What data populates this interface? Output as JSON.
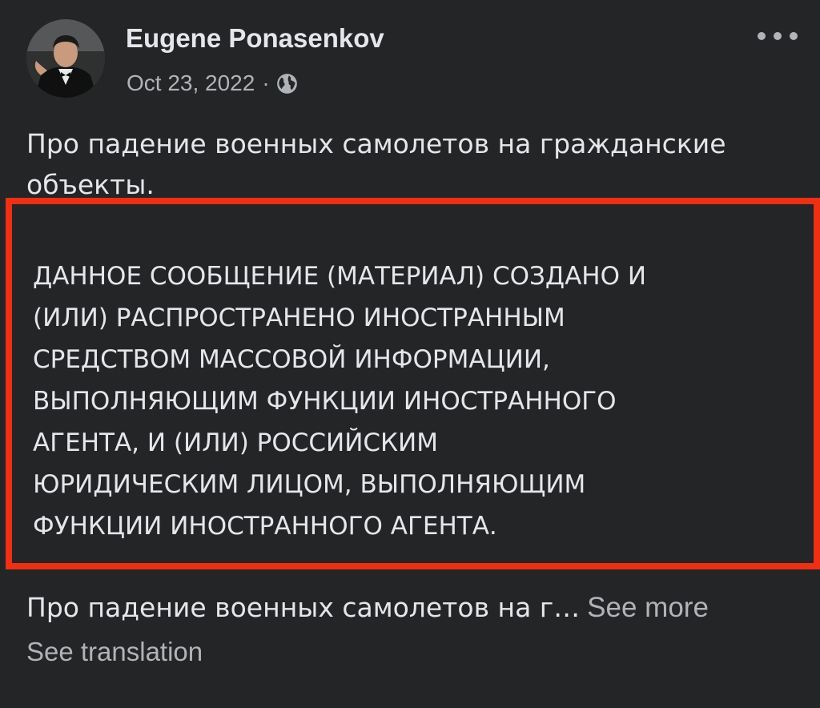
{
  "post": {
    "author_name": "Eugene Ponasenkov",
    "date": "Oct 23, 2022",
    "separator": "·",
    "visibility_icon": "globe-icon",
    "menu_icon": "more-options-icon",
    "intro_text": "Про падение военных самолетов на гражданские объекты.",
    "disclaimer_text": "ДАННОЕ СООБЩЕНИЕ (МАТЕРИАЛ) СОЗДАНО И\n(ИЛИ) РАСПРОСТРАНЕНО ИНОСТРАННЫМ\nСРЕДСТВОМ МАССОВОЙ ИНФОРМАЦИИ,\nВЫПОЛНЯЮЩИМ ФУНКЦИИ ИНОСТРАННОГО\nАГЕНТА, И (ИЛИ) РОССИЙСКИМ\nЮРИДИЧЕСКИМ ЛИЦОМ, ВЫПОЛНЯЮЩИМ\nФУНКЦИИ ИНОСТРАННОГО АГЕНТА.",
    "summary_text": "Про падение военных самолетов на г…",
    "see_more_label": "See more",
    "see_translation_label": "See translation"
  },
  "colors": {
    "background": "#242526",
    "primary_text": "#e4e6eb",
    "secondary_text": "#b0b3b8",
    "highlight_border": "#ef2e13"
  }
}
